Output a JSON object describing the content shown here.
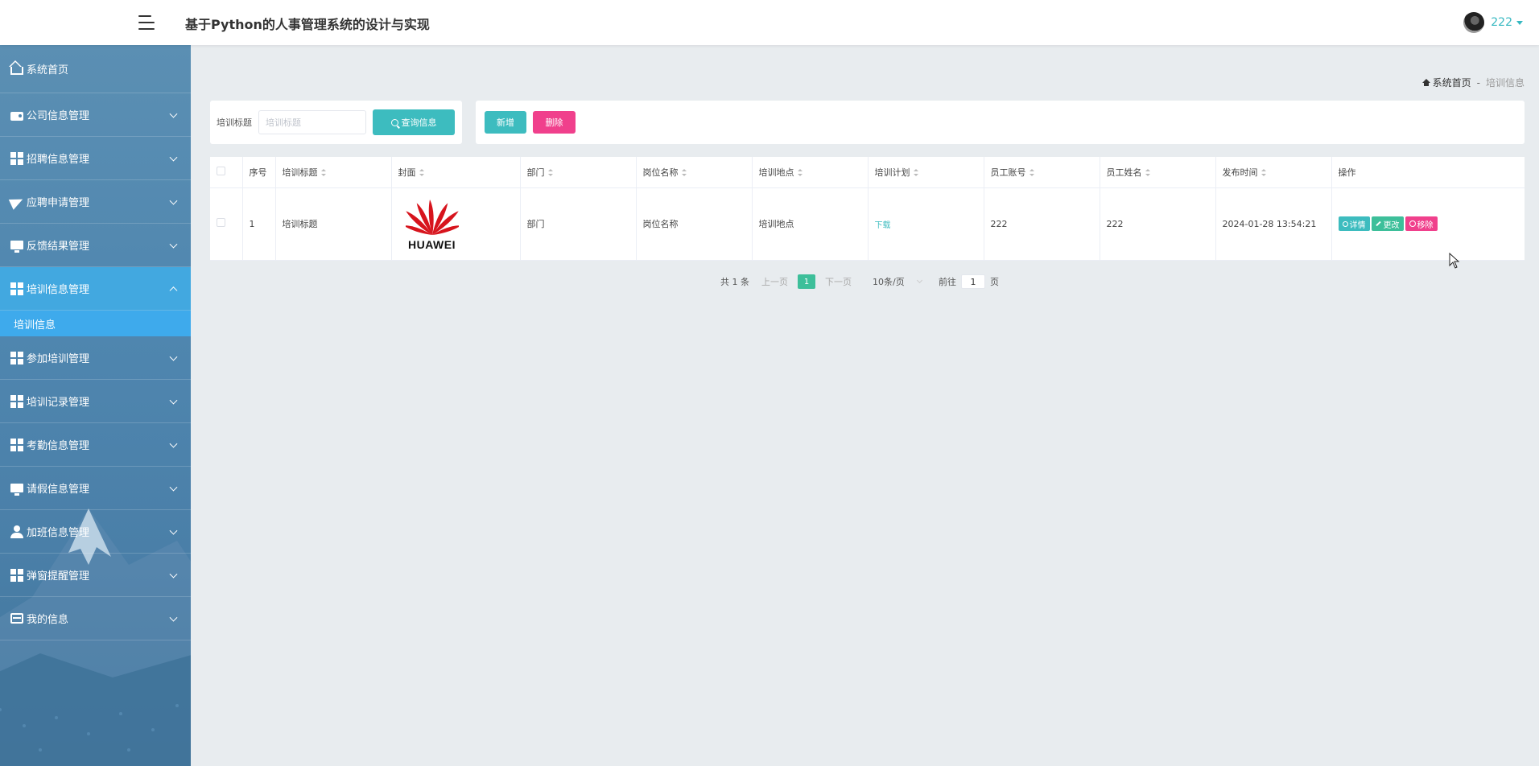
{
  "header": {
    "title": "基于Python的人事管理系统的设计与实现",
    "username": "222"
  },
  "sidebar": {
    "home": "系统首页",
    "items": [
      {
        "label": "公司信息管理",
        "icon": "wallet-icon"
      },
      {
        "label": "招聘信息管理",
        "icon": "grid-icon"
      },
      {
        "label": "应聘申请管理",
        "icon": "plane-icon"
      },
      {
        "label": "反馈结果管理",
        "icon": "monitor-icon"
      },
      {
        "label": "培训信息管理",
        "icon": "grid-icon",
        "expanded": true
      },
      {
        "label": "参加培训管理",
        "icon": "grid-icon"
      },
      {
        "label": "培训记录管理",
        "icon": "grid-icon"
      },
      {
        "label": "考勤信息管理",
        "icon": "grid-icon"
      },
      {
        "label": "请假信息管理",
        "icon": "monitor-icon"
      },
      {
        "label": "加班信息管理",
        "icon": "person-icon"
      },
      {
        "label": "弹窗提醒管理",
        "icon": "grid-icon"
      },
      {
        "label": "我的信息",
        "icon": "card-icon"
      }
    ],
    "submenu": {
      "label": "培训信息"
    }
  },
  "breadcrumb": {
    "home": "系统首页",
    "separator": "-",
    "current": "培训信息"
  },
  "search": {
    "label": "培训标题",
    "placeholder": "培训标题",
    "value": "",
    "button": "查询信息"
  },
  "actions": {
    "add": "新增",
    "delete": "删除"
  },
  "table": {
    "columns": [
      "序号",
      "培训标题",
      "封面",
      "部门",
      "岗位名称",
      "培训地点",
      "培训计划",
      "员工账号",
      "员工姓名",
      "发布时间",
      "操作"
    ],
    "rows": [
      {
        "index": "1",
        "title": "培训标题",
        "cover_logo": "HUAWEI",
        "department": "部门",
        "position": "岗位名称",
        "location": "培训地点",
        "plan": "下载",
        "account": "222",
        "name": "222",
        "published": "2024-01-28 13:54:21",
        "ops": {
          "detail": "详情",
          "edit": "更改",
          "remove": "移除"
        }
      }
    ]
  },
  "pagination": {
    "total": "共 1 条",
    "prev": "上一页",
    "current_page": "1",
    "next": "下一页",
    "page_size": "10条/页",
    "goto_prefix": "前往",
    "goto_value": "1",
    "goto_suffix": "页"
  },
  "colors": {
    "accent": "#3dbcbf",
    "danger": "#f0408c",
    "active_menu": "#42a8e0"
  }
}
